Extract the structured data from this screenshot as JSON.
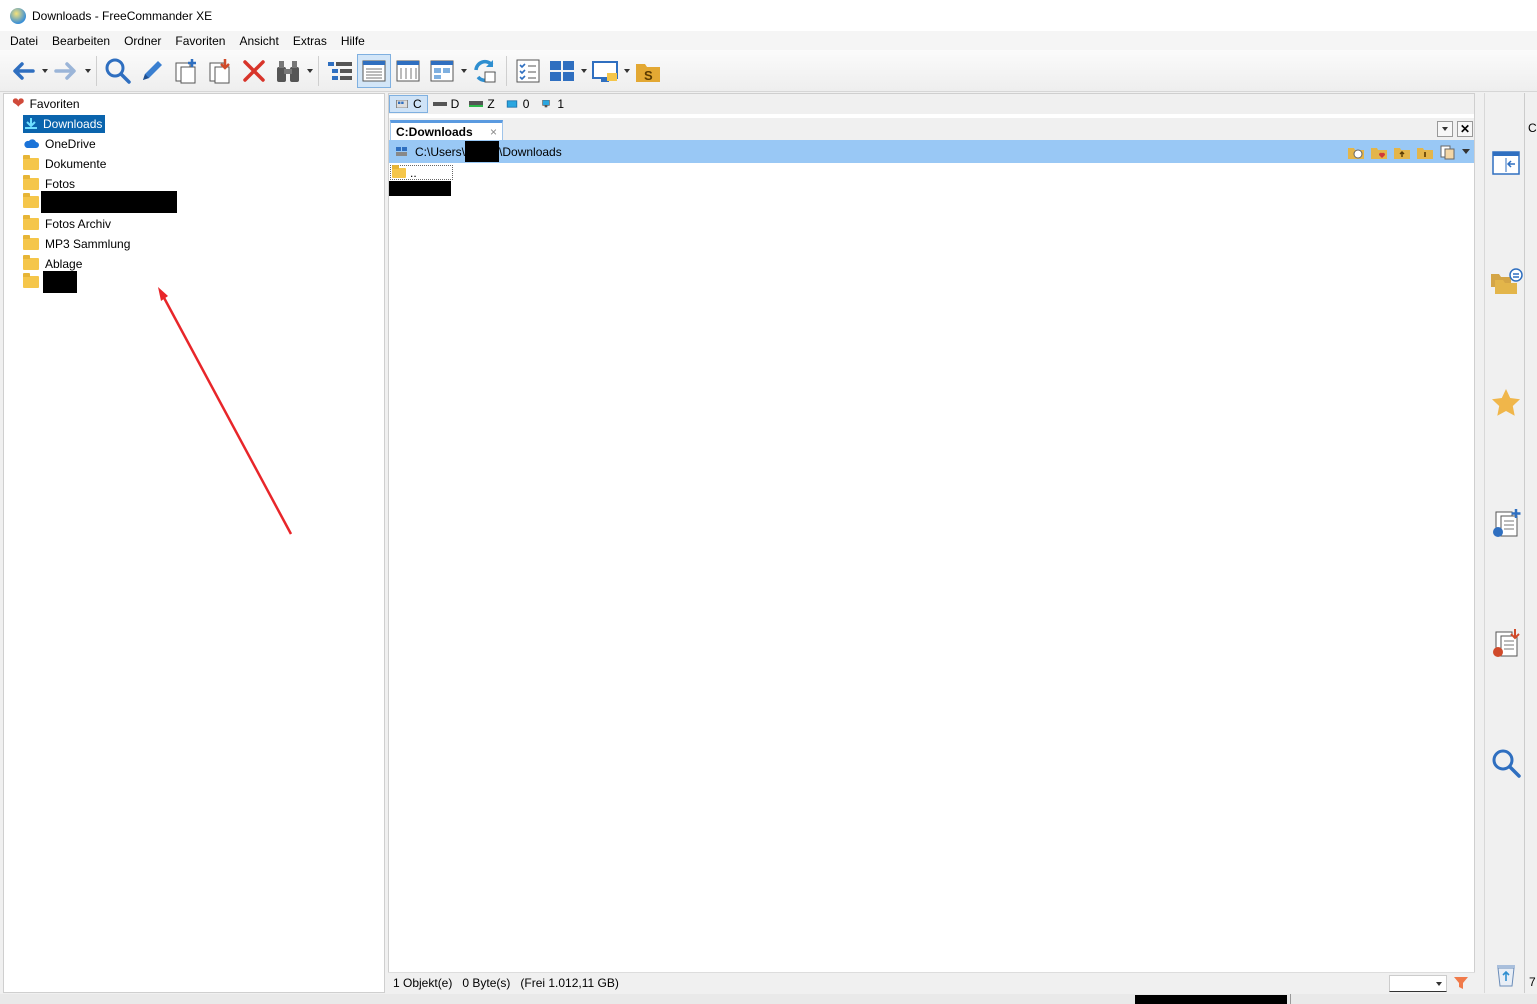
{
  "window": {
    "title": "Downloads - FreeCommander XE"
  },
  "menu": [
    "Datei",
    "Bearbeiten",
    "Ordner",
    "Favoriten",
    "Ansicht",
    "Extras",
    "Hilfe"
  ],
  "favorites": {
    "root_label": "Favoriten",
    "items": [
      {
        "label": "Downloads",
        "icon": "download-icon",
        "selected": true,
        "redacted": false
      },
      {
        "label": "OneDrive",
        "icon": "cloud-icon",
        "selected": false,
        "redacted": false
      },
      {
        "label": "Dokumente",
        "icon": "folder-icon",
        "selected": false,
        "redacted": false
      },
      {
        "label": "Fotos",
        "icon": "folder-icon",
        "selected": false,
        "redacted": false
      },
      {
        "label": "",
        "icon": "folder-icon",
        "selected": false,
        "redacted": true
      },
      {
        "label": "Fotos Archiv",
        "icon": "folder-icon",
        "selected": false,
        "redacted": false
      },
      {
        "label": "MP3 Sammlung",
        "icon": "folder-icon",
        "selected": false,
        "redacted": false
      },
      {
        "label": "Ablage",
        "icon": "folder-icon",
        "selected": false,
        "redacted": false
      },
      {
        "label": "",
        "icon": "folder-icon",
        "selected": false,
        "redacted": true
      }
    ]
  },
  "drives": [
    {
      "label": "C",
      "active": true
    },
    {
      "label": "D",
      "active": false
    },
    {
      "label": "Z",
      "active": false
    },
    {
      "label": "0",
      "active": false
    },
    {
      "label": "1",
      "active": false
    }
  ],
  "tab": {
    "label": "C:Downloads",
    "close": "×"
  },
  "path": {
    "prefix": "C:\\Users\\",
    "suffix": "\\Downloads"
  },
  "file_list": {
    "parent_entry": ".."
  },
  "status": {
    "objects": "1 Objekt(e)",
    "bytes": "0 Byte(s)",
    "free": "(Frei 1.012,11 GB)"
  },
  "far_right": {
    "top_letter": "C",
    "bottom_digit": "7"
  },
  "colors": {
    "selection": "#0a64ad",
    "pathbar": "#99c8f5",
    "annotation_arrow": "#e8262a"
  }
}
